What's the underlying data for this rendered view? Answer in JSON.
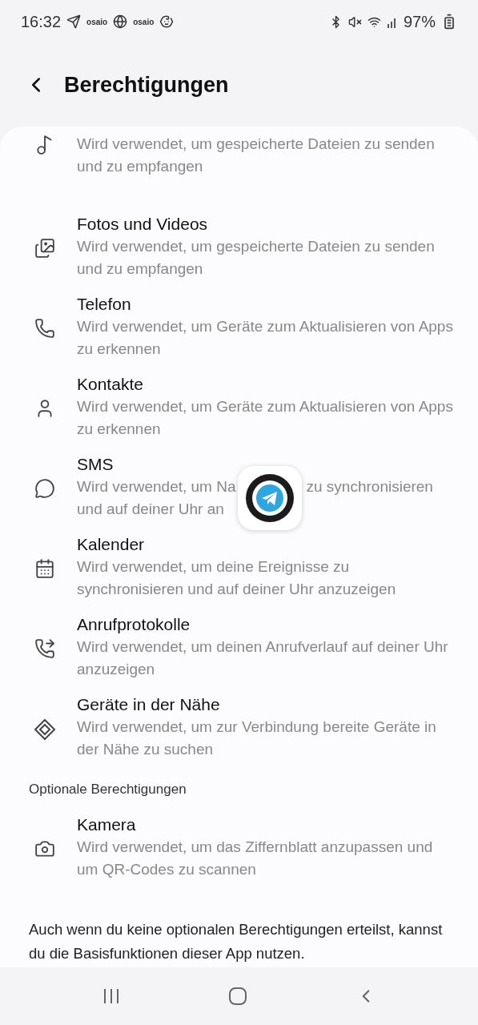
{
  "status_bar": {
    "time": "16:32",
    "notification_labels": [
      "osaio",
      "osaio"
    ],
    "battery": "97%"
  },
  "header": {
    "title": "Berechtigungen"
  },
  "permissions": [
    {
      "description": "Wird verwendet, um gespeicherte Dateien zu senden und zu empfangen"
    },
    {
      "title": "Fotos und Videos",
      "description": "Wird verwendet, um gespeicherte Dateien zu senden und zu empfangen"
    },
    {
      "title": "Telefon",
      "description": "Wird verwendet, um Geräte zum Aktualisieren von Apps zu erkennen"
    },
    {
      "title": "Kontakte",
      "description": "Wird verwendet, um Geräte zum Aktualisieren von Apps zu erkennen"
    },
    {
      "title": "SMS",
      "description_lines": [
        [
          "Wird verwendet, um Na",
          "zu synchronisieren"
        ],
        [
          "und auf deiner Uhr an"
        ]
      ]
    },
    {
      "title": "Kalender",
      "description": "Wird verwendet, um deine Ereignisse zu synchronisieren und auf deiner Uhr anzuzeigen"
    },
    {
      "title": "Anrufprotokolle",
      "description": "Wird verwendet, um deinen Anrufverlauf auf deiner Uhr anzuzeigen"
    },
    {
      "title": "Geräte in der Nähe",
      "description": "Wird verwendet, um zur Verbindung bereite Geräte in der Nähe zu suchen"
    }
  ],
  "optional_section": {
    "heading": "Optionale Berechtigungen",
    "permissions": [
      {
        "title": "Kamera",
        "description": "Wird verwendet, um das Ziffernblatt anzupassen und um QR-Codes zu scannen"
      }
    ]
  },
  "footer_note": "Auch wenn du keine optionalen Berechtigungen erteilst, kannst du die Basisfunktionen dieser App nutzen."
}
